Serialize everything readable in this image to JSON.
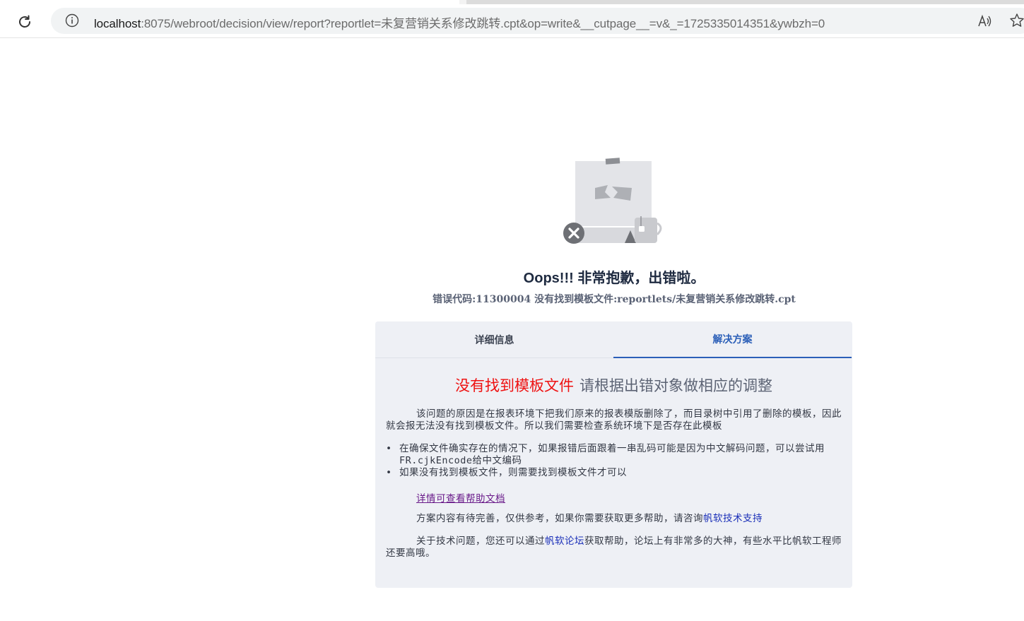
{
  "browser": {
    "url_host": "localhost",
    "url_rest": ":8075/webroot/decision/view/report?reportlet=未复营销关系修改跳转.cpt&op=write&__cutpage__=v&_=1725335014351&ywbzh=0"
  },
  "error": {
    "title": "Oops!!! 非常抱歉，出错啦。",
    "subtitle": "错误代码:11300004 没有找到模板文件:reportlets/未复营销关系修改跳转.cpt"
  },
  "tabs": [
    {
      "label": "详细信息"
    },
    {
      "label": "解决方案"
    }
  ],
  "solution": {
    "heading_red": "没有找到模板文件",
    "heading_gray": "请根据出错对象做相应的调整",
    "para1": "该问题的原因是在报表环境下把我们原来的报表模版删除了，而目录树中引用了删除的模板，因此就会报无法没有找到模板文件。所以我们需要检查系统环境下是否存在此模板",
    "bullets": [
      "在确保文件确实存在的情况下，如果报错后面跟着一串乱码可能是因为中文解码问题，可以尝试用FR.cjkEncode给中文编码",
      "如果没有找到模板文件，则需要找到模板文件才可以"
    ],
    "help_link": "详情可查看帮助文档",
    "para2_text": "方案内容有待完善，仅供参考，如果你需要获取更多帮助，请咨询",
    "para2_link": "帆软技术支持",
    "para3_pre": "关于技术问题，您还可以通过",
    "para3_link": "帆软论坛",
    "para3_post": "获取帮助，论坛上有非常多的大神，有些水平比帆软工程师还要高哦。"
  }
}
